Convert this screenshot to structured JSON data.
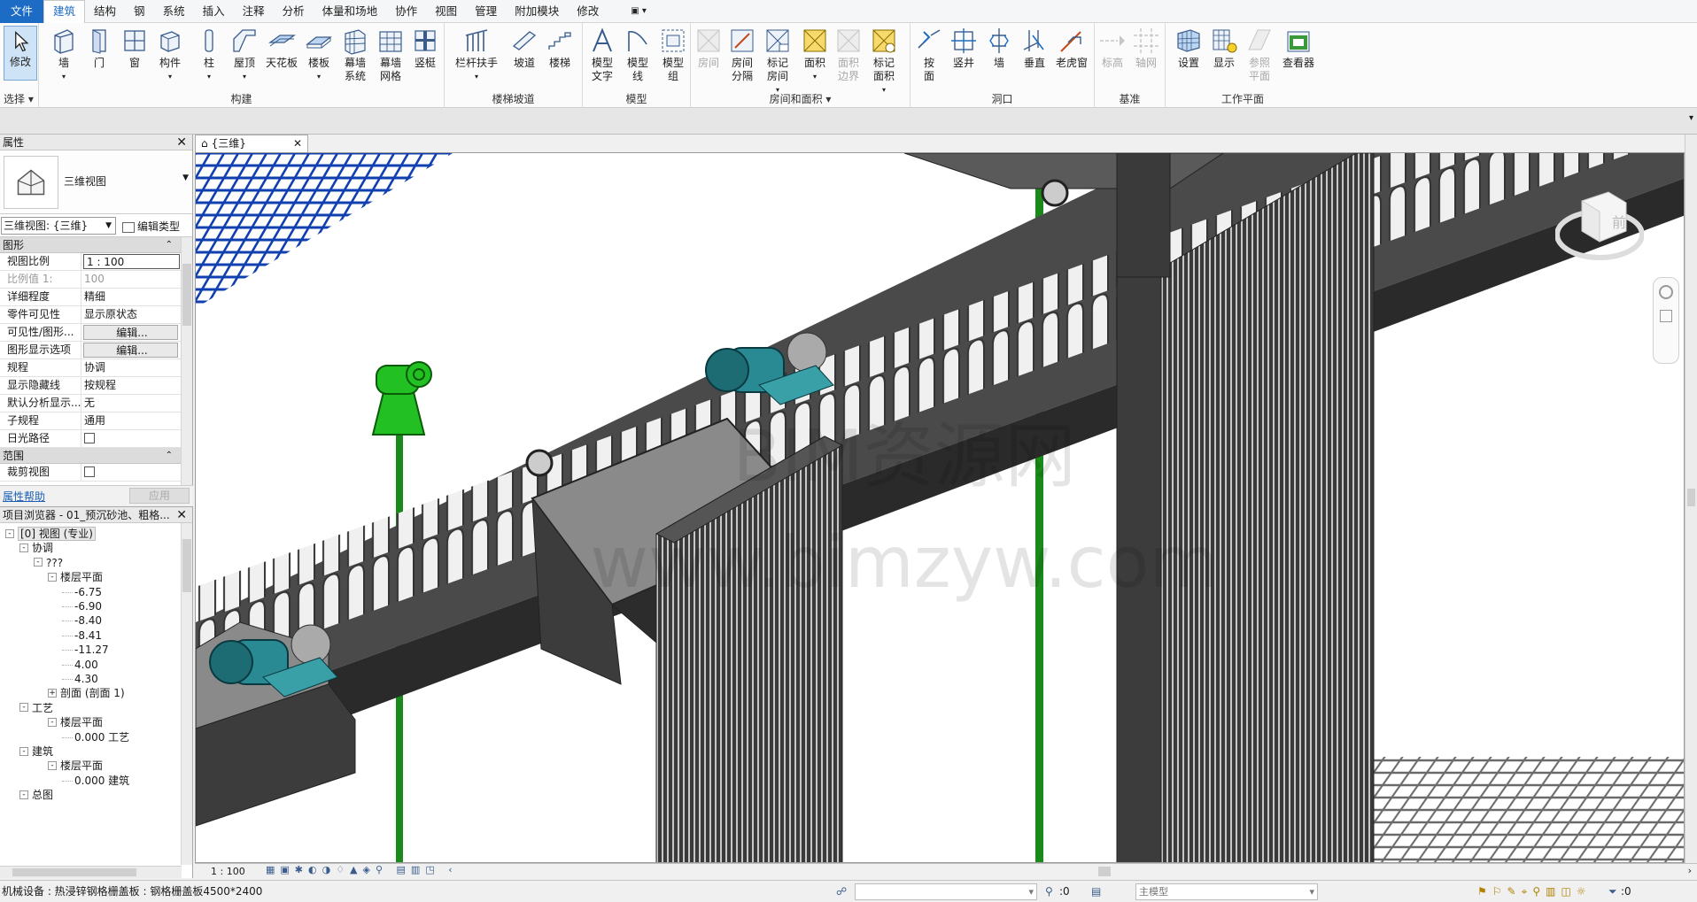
{
  "menu": {
    "items": [
      "文件",
      "建筑",
      "结构",
      "钢",
      "系统",
      "插入",
      "注释",
      "分析",
      "体量和场地",
      "协作",
      "视图",
      "管理",
      "附加模块",
      "修改"
    ],
    "active_index": 1,
    "quick_access": "▣ ▾"
  },
  "ribbon": {
    "select": {
      "modify": "修改",
      "panel": "选择"
    },
    "build": {
      "wall": "墙",
      "door": "门",
      "window": "窗",
      "component": "构件",
      "column": "柱",
      "roof": "屋顶",
      "ceiling": "天花板",
      "floor": "楼板",
      "curtain_system": "幕墙\n系统",
      "curtain_grid": "幕墙\n网格",
      "mullion": "竖梃",
      "panel": "构建"
    },
    "circulation": {
      "railing": "栏杆扶手",
      "ramp": "坡道",
      "stair": "楼梯",
      "panel": "楼梯坡道"
    },
    "model": {
      "model_text": "模型\n文字",
      "model_line": "模型\n线",
      "model_group": "模型\n组",
      "panel": "模型"
    },
    "room": {
      "room": "房间",
      "room_sep": "房间\n分隔",
      "tag_room": "标记\n房间",
      "area": "面积",
      "area_boundary": "面积\n边界",
      "tag_area": "标记\n面积",
      "panel": "房间和面积 ▾"
    },
    "opening": {
      "by_face": "按\n面",
      "shaft": "竖井",
      "wall": "墙",
      "vertical": "垂直",
      "dormer": "老虎窗",
      "panel": "洞口"
    },
    "datum": {
      "level": "标高",
      "grid": "轴网",
      "panel": "基准"
    },
    "workplane": {
      "set": "设置",
      "show": "显示",
      "ref_plane": "参照\n平面",
      "viewer": "查看器",
      "panel": "工作平面"
    }
  },
  "properties": {
    "title": "属性",
    "type_name": "三维视图",
    "view_selector": "三维视图: {三维}",
    "edit_type": "编辑类型",
    "section_graphics": "图形",
    "section_extents": "范围",
    "rows": [
      {
        "k": "视图比例",
        "v": "1 : 100",
        "style": "inp"
      },
      {
        "k": "比例值 1:",
        "v": "100",
        "style": "grey"
      },
      {
        "k": "详细程度",
        "v": "精细",
        "style": ""
      },
      {
        "k": "零件可见性",
        "v": "显示原状态",
        "style": ""
      },
      {
        "k": "可见性/图形...",
        "v": "编辑...",
        "style": "btn"
      },
      {
        "k": "图形显示选项",
        "v": "编辑...",
        "style": "btn"
      },
      {
        "k": "规程",
        "v": "协调",
        "style": ""
      },
      {
        "k": "显示隐藏线",
        "v": "按规程",
        "style": ""
      },
      {
        "k": "默认分析显示...",
        "v": "无",
        "style": ""
      },
      {
        "k": "子规程",
        "v": "通用",
        "style": ""
      },
      {
        "k": "日光路径",
        "v": "",
        "style": "chk"
      }
    ],
    "crop_row": {
      "k": "裁剪视图",
      "v": ""
    },
    "help": "属性帮助",
    "apply": "应用"
  },
  "browser": {
    "title": "项目浏览器 - 01_预沉砂池、粗格...",
    "nodes": [
      {
        "t": "[0] 视图 (专业)",
        "lvl": 0,
        "tog": "-",
        "hl": true
      },
      {
        "t": "协调",
        "lvl": 1,
        "tog": "-"
      },
      {
        "t": "???",
        "lvl": 2,
        "tog": "-"
      },
      {
        "t": "楼层平面",
        "lvl": 3,
        "tog": "-"
      },
      {
        "t": "-6.75",
        "lvl": 4,
        "tog": ""
      },
      {
        "t": "-6.90",
        "lvl": 4,
        "tog": ""
      },
      {
        "t": "-8.40",
        "lvl": 4,
        "tog": ""
      },
      {
        "t": "-8.41",
        "lvl": 4,
        "tog": ""
      },
      {
        "t": "-11.27",
        "lvl": 4,
        "tog": ""
      },
      {
        "t": "4.00",
        "lvl": 4,
        "tog": ""
      },
      {
        "t": "4.30",
        "lvl": 4,
        "tog": ""
      },
      {
        "t": "剖面 (剖面 1)",
        "lvl": 3,
        "tog": "+"
      },
      {
        "t": "工艺",
        "lvl": 1,
        "tog": "-"
      },
      {
        "t": "楼层平面",
        "lvl": 3,
        "tog": "-"
      },
      {
        "t": "0.000 工艺",
        "lvl": 4,
        "tog": ""
      },
      {
        "t": "建筑",
        "lvl": 1,
        "tog": "-"
      },
      {
        "t": "楼层平面",
        "lvl": 3,
        "tog": "-"
      },
      {
        "t": "0.000 建筑",
        "lvl": 4,
        "tog": ""
      },
      {
        "t": "总图",
        "lvl": 1,
        "tog": "-"
      }
    ]
  },
  "view_tab": "{三维}",
  "viewport": {
    "watermark1": "BIM资源网",
    "watermark2": "www.bimzyw.com",
    "viewcube_face": "前"
  },
  "viewbar": {
    "scale": "1 : 100"
  },
  "status": {
    "message": "机械设备 : 热浸锌钢格栅盖板 : 钢格栅盖板4500*2400",
    "workset": ":0",
    "model": "主模型",
    "filter": ":0"
  },
  "colors": {
    "accent": "#1c6bc4",
    "green": "#22b022",
    "body": "#4c4c4c",
    "motor": "#2a8a94"
  }
}
